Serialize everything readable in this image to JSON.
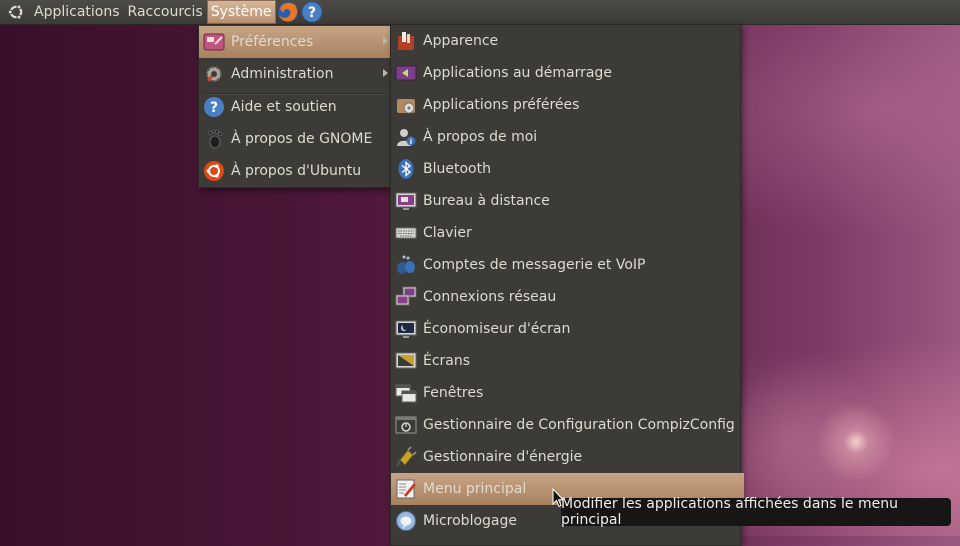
{
  "panel": {
    "menus": [
      "Applications",
      "Raccourcis",
      "Système"
    ],
    "launchers": [
      "firefox-icon",
      "help-icon"
    ]
  },
  "system_menu": {
    "items": [
      {
        "label": "Préférences",
        "icon": "preferences-icon",
        "submenu": true,
        "highlighted": true
      },
      {
        "label": "Administration",
        "icon": "administration-icon",
        "submenu": true
      },
      {
        "label": "Aide et soutien",
        "icon": "help-icon"
      },
      {
        "label": "À propos de GNOME",
        "icon": "gnome-foot-icon"
      },
      {
        "label": "À propos d'Ubuntu",
        "icon": "ubuntu-logo-icon"
      }
    ]
  },
  "preferences_menu": {
    "items": [
      {
        "label": "Apparence",
        "icon": "appearance-icon"
      },
      {
        "label": "Applications au démarrage",
        "icon": "startup-applications-icon"
      },
      {
        "label": "Applications préférées",
        "icon": "preferred-applications-icon"
      },
      {
        "label": "À propos de moi",
        "icon": "about-me-icon"
      },
      {
        "label": "Bluetooth",
        "icon": "bluetooth-icon"
      },
      {
        "label": "Bureau à distance",
        "icon": "remote-desktop-icon"
      },
      {
        "label": "Clavier",
        "icon": "keyboard-icon"
      },
      {
        "label": "Comptes de messagerie et VoIP",
        "icon": "messaging-accounts-icon"
      },
      {
        "label": "Connexions réseau",
        "icon": "network-connections-icon"
      },
      {
        "label": "Économiseur d'écran",
        "icon": "screensaver-icon"
      },
      {
        "label": "Écrans",
        "icon": "displays-icon"
      },
      {
        "label": "Fenêtres",
        "icon": "windows-icon"
      },
      {
        "label": "Gestionnaire de Configuration CompizConfig",
        "icon": "compizconfig-icon"
      },
      {
        "label": "Gestionnaire d'énergie",
        "icon": "power-manager-icon"
      },
      {
        "label": "Menu principal",
        "icon": "main-menu-icon",
        "highlighted": true
      },
      {
        "label": "Microblogage",
        "icon": "microblogging-icon"
      }
    ]
  },
  "tooltip": {
    "text": "Modifier les applications affichées dans le menu principal"
  }
}
